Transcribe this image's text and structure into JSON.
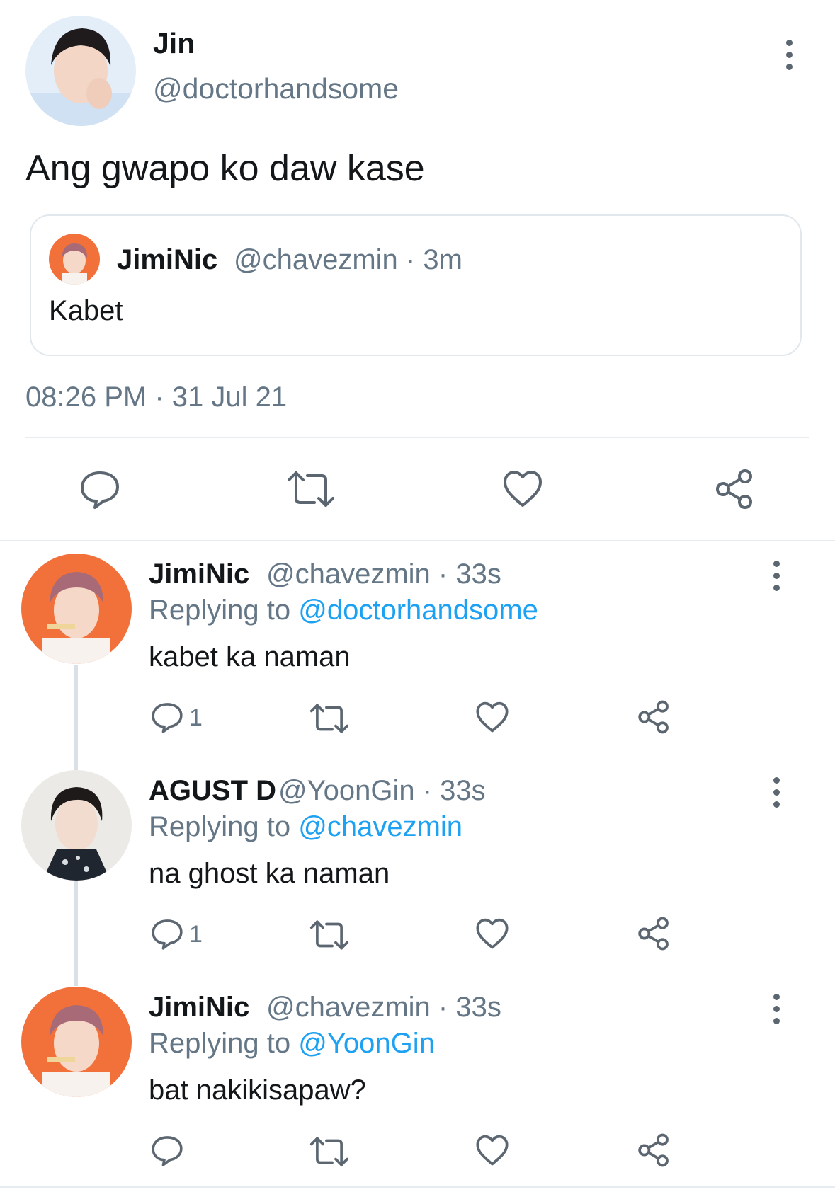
{
  "main_tweet": {
    "name": "Jin",
    "handle": "@doctorhandsome",
    "text": "Ang gwapo ko daw kase",
    "quote": {
      "name": "JimiNic",
      "meta": "@chavezmin · 3m",
      "text": "Kabet"
    },
    "timestamp": "08:26 PM · 31 Jul 21",
    "actions": [
      "reply-icon",
      "retweet-icon",
      "like-icon",
      "share-icon"
    ]
  },
  "replies": [
    {
      "name": "JimiNic",
      "meta": "@chavezmin · 33s",
      "replying_prefix": "Replying to ",
      "replying_to": "@doctorhandsome",
      "text": "kabet ka naman",
      "reply_count": "1"
    },
    {
      "name": "AGUST D",
      "meta": "@YoonGin · 33s",
      "replying_prefix": "Replying to ",
      "replying_to": "@chavezmin",
      "text": "na ghost ka naman",
      "reply_count": "1"
    },
    {
      "name": "JimiNic",
      "meta": "@chavezmin · 33s",
      "replying_prefix": "Replying to ",
      "replying_to": "@YoonGin",
      "text": "bat nakikisapaw?",
      "reply_count": ""
    }
  ],
  "colors": {
    "text": "#14171a",
    "secondary": "#657786",
    "link": "#1da1f2",
    "divider": "#e6ecf0"
  }
}
